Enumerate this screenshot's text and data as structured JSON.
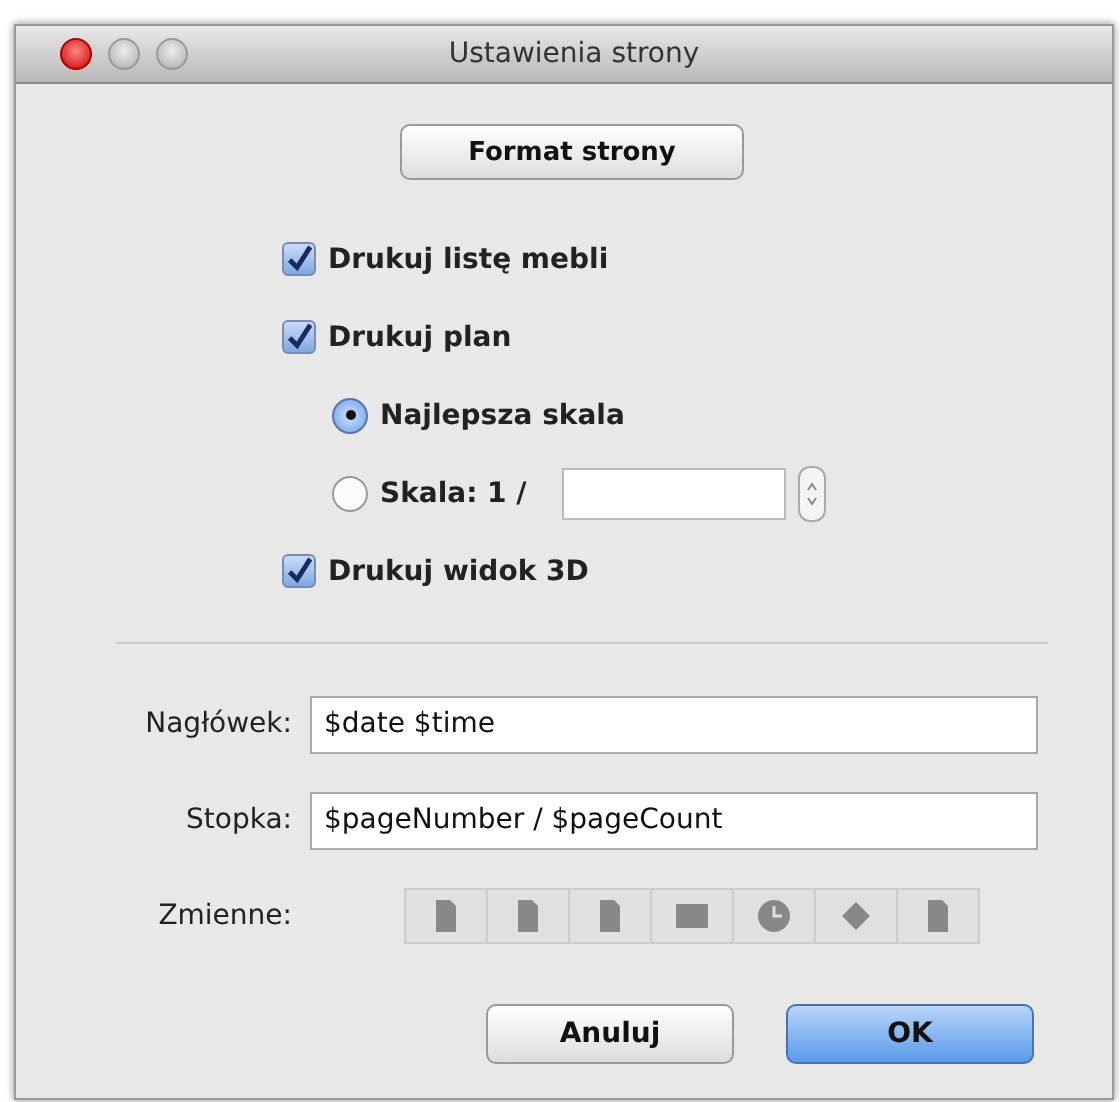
{
  "window": {
    "title": "Ustawienia strony"
  },
  "format_button": "Format strony",
  "options": [
    {
      "kind": "checkbox",
      "label": "Drukuj listę mebli",
      "checked": true
    },
    {
      "kind": "checkbox",
      "label": "Drukuj plan",
      "checked": true,
      "children": [
        {
          "kind": "radio",
          "label": "Najlepsza skala",
          "selected": true
        },
        {
          "kind": "radio",
          "label": "Skala: 1 /",
          "selected": false,
          "has_scale_field": true
        }
      ]
    },
    {
      "kind": "checkbox",
      "label": "Drukuj widok 3D",
      "checked": true
    }
  ],
  "fields": [
    {
      "label": "Nagłówek:",
      "value": "$date $time"
    },
    {
      "label": "Stopka:",
      "value": "$pageNumber / $pageCount"
    }
  ],
  "variables": {
    "label": "Zmienne:"
  },
  "buttons": [
    {
      "label": "Anuluj",
      "default": false
    },
    {
      "label": "OK",
      "default": true
    }
  ]
}
